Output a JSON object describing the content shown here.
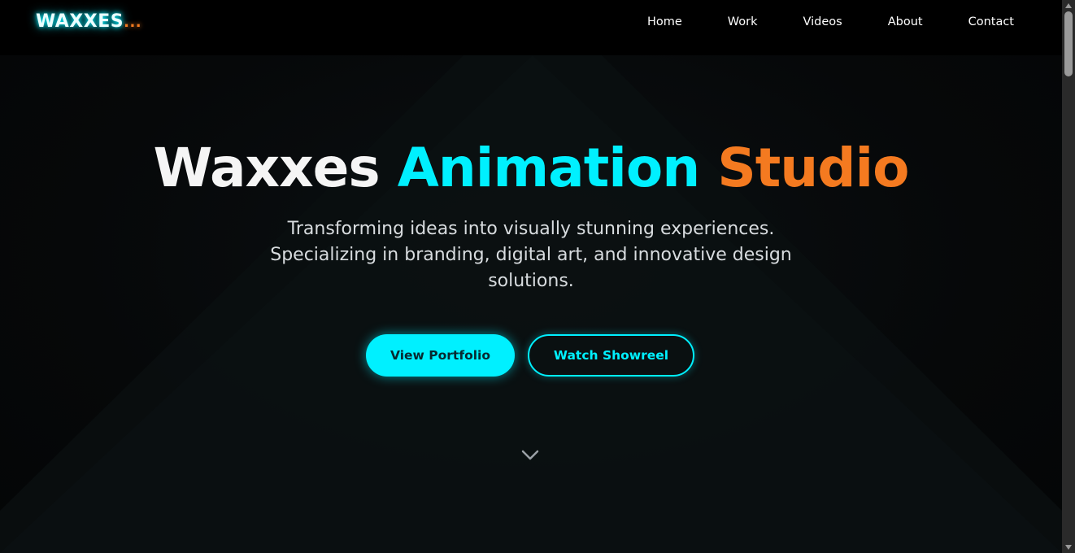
{
  "brand": {
    "logo_text": "WAXXES",
    "logo_dots": "...",
    "cyan": "#00f0ff",
    "orange": "#f47a20"
  },
  "nav": {
    "items": [
      {
        "label": "Home"
      },
      {
        "label": "Work"
      },
      {
        "label": "Videos"
      },
      {
        "label": "About"
      },
      {
        "label": "Contact"
      }
    ]
  },
  "hero": {
    "title_part1": "Waxxes",
    "title_part2": "Animation",
    "title_part3": "Studio",
    "subtitle": "Transforming ideas into visually stunning experiences. Specializing in branding, digital art, and innovative design solutions.",
    "primary_button": "View Portfolio",
    "secondary_button": "Watch Showreel",
    "scroll_icon": "chevron-down-icon"
  }
}
